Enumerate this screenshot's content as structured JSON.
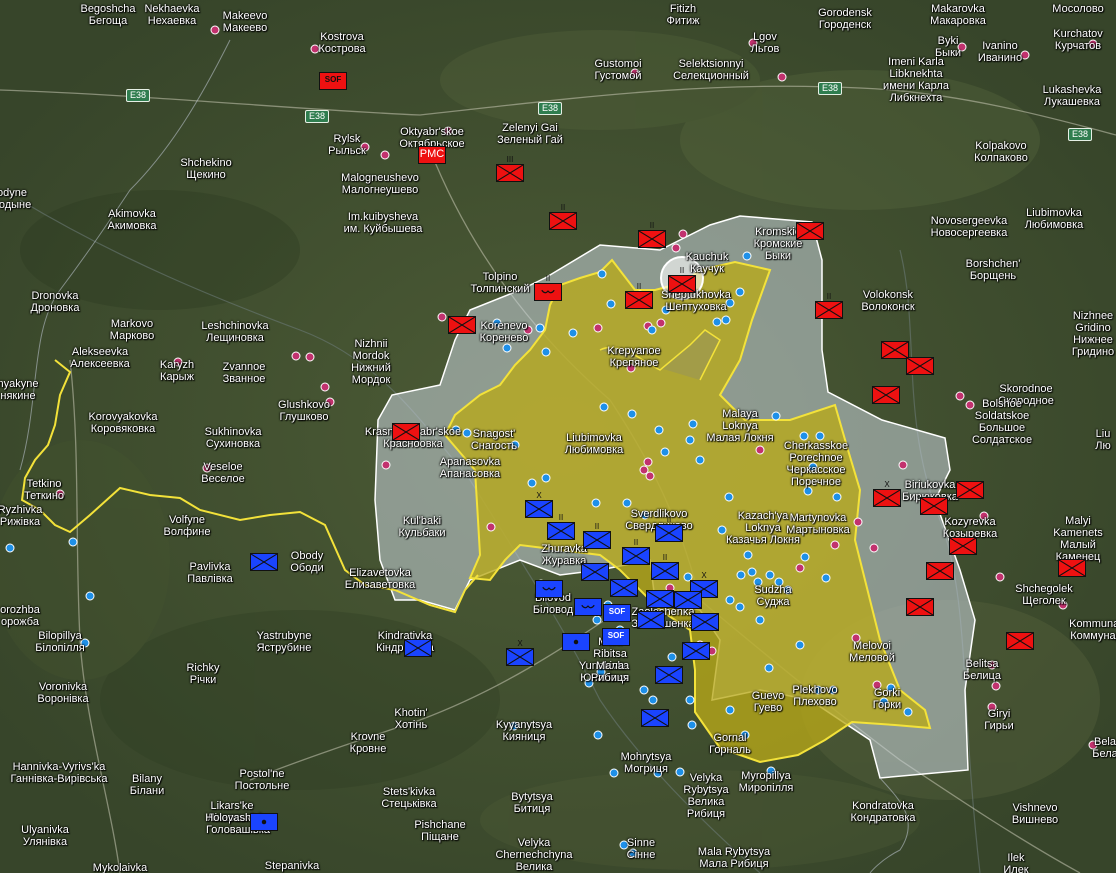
{
  "colors": {
    "ru_unit": "#ee1111",
    "ua_unit": "#1a44ff",
    "control_area": "#b8a918",
    "contested_area": "#c9d3dc",
    "border": "#f3e23a",
    "town_dot": "#c2326e",
    "control_dot": "#1e90e8"
  },
  "roads": [
    {
      "id": "e38-a",
      "label": "E38"
    },
    {
      "id": "e38-b",
      "label": "E38"
    },
    {
      "id": "e38-c",
      "label": "E38"
    },
    {
      "id": "e38-d",
      "label": "E38"
    },
    {
      "id": "e38-e",
      "label": "E38"
    }
  ],
  "places": [
    {
      "id": "begoshcha",
      "lines": [
        "Begoshcha",
        "Бегоща"
      ]
    },
    {
      "id": "nekhaevka",
      "lines": [
        "Nekhaevka",
        "Нехаевка"
      ]
    },
    {
      "id": "makeevo",
      "lines": [
        "Makeevo",
        "Макеево"
      ]
    },
    {
      "id": "kostrova",
      "lines": [
        "Kostrova",
        "Кострова"
      ]
    },
    {
      "id": "fitizh",
      "lines": [
        "Fitizh",
        "Фитиж"
      ]
    },
    {
      "id": "lgov",
      "lines": [
        "Lgov",
        "Льгов"
      ]
    },
    {
      "id": "gorodensk",
      "lines": [
        "Gorodensk",
        "Городенск"
      ]
    },
    {
      "id": "makarovka",
      "lines": [
        "Makarovka",
        "Макаровка"
      ]
    },
    {
      "id": "mosolovo",
      "lines": [
        "",
        "Мосолово"
      ]
    },
    {
      "id": "byki",
      "lines": [
        "Byki",
        "Быки"
      ]
    },
    {
      "id": "ivanino",
      "lines": [
        "Ivanino",
        "Иванино"
      ]
    },
    {
      "id": "kurchatov",
      "lines": [
        "Kurchatov",
        "Курчатов"
      ]
    },
    {
      "id": "gustomoi",
      "lines": [
        "Gustomoi",
        "Густомой"
      ]
    },
    {
      "id": "selektsionnyi",
      "lines": [
        "Selektsionnyi",
        "Селекционный"
      ]
    },
    {
      "id": "imeni-karla",
      "lines": [
        "Imeni Karla",
        "Libknekhta",
        "имени Карла",
        "Либкнехта"
      ]
    },
    {
      "id": "lukashevka",
      "lines": [
        "Lukashevka",
        "Лукашевка"
      ]
    },
    {
      "id": "rylsk",
      "lines": [
        "Rylsk",
        "Рыльск"
      ]
    },
    {
      "id": "oktyabrskoe",
      "lines": [
        "Oktyabr'skoe",
        "Октябрьское"
      ]
    },
    {
      "id": "zelenyi-gai",
      "lines": [
        "Zelenyi Gai",
        "Зеленый Гай"
      ]
    },
    {
      "id": "malogneushevo",
      "lines": [
        "Malogneushevo",
        "Малогнеушево"
      ]
    },
    {
      "id": "shchekino",
      "lines": [
        "Shchekino",
        "Щекино"
      ]
    },
    {
      "id": "kolpakovo",
      "lines": [
        "Kolpakovo",
        "Колпаково"
      ]
    },
    {
      "id": "odyne",
      "lines": [
        "odyne",
        "родыне"
      ]
    },
    {
      "id": "akimovka",
      "lines": [
        "Akimovka",
        "Акимовка"
      ]
    },
    {
      "id": "kuibysheva",
      "lines": [
        "Im.kuibysheva",
        "им. Куйбышева"
      ]
    },
    {
      "id": "novosergeevka",
      "lines": [
        "Novosergeevka",
        "Новосергеевка"
      ]
    },
    {
      "id": "liubimovka-ne",
      "lines": [
        "Liubimovka",
        "Любимовка"
      ]
    },
    {
      "id": "kromskie-byki",
      "lines": [
        "Kromskie",
        "Кромские",
        "Быки"
      ]
    },
    {
      "id": "kauchuk",
      "lines": [
        "Kauchuk",
        "Каучук"
      ]
    },
    {
      "id": "tolpino",
      "lines": [
        "Tolpino",
        "Толпинский"
      ]
    },
    {
      "id": "sheptukhovka",
      "lines": [
        "Sheptukhovka",
        "Шептуховка"
      ]
    },
    {
      "id": "borshchen",
      "lines": [
        "Borshchen'",
        "Борщень"
      ]
    },
    {
      "id": "dronovka",
      "lines": [
        "Dronovka",
        "Дроновка"
      ]
    },
    {
      "id": "volokonsk",
      "lines": [
        "Volokonsk",
        "Волоконск"
      ]
    },
    {
      "id": "korenevo",
      "lines": [
        "Korenevo",
        "Коренево"
      ]
    },
    {
      "id": "markovo",
      "lines": [
        "Markovo",
        "Марково"
      ]
    },
    {
      "id": "leshchinovka",
      "lines": [
        "Leshchinovka",
        "Лещиновка"
      ]
    },
    {
      "id": "nizhnii-mordok",
      "lines": [
        "Nizhnii",
        "Mordok",
        "Нижний",
        "Мордок"
      ]
    },
    {
      "id": "krepyanoe",
      "lines": [
        "Krepyanoe",
        "Крепяное"
      ]
    },
    {
      "id": "nizhnee-gridino",
      "lines": [
        "Nizhnee",
        "Gridino",
        "Нижнее",
        "Гридино"
      ]
    },
    {
      "id": "alekseevka",
      "lines": [
        "Alekseevka",
        "Алексеевка"
      ]
    },
    {
      "id": "karyzh",
      "lines": [
        "Karyzh",
        "Карыж"
      ]
    },
    {
      "id": "zvannoe",
      "lines": [
        "Zvannoe",
        "Званное"
      ]
    },
    {
      "id": "glushkovo",
      "lines": [
        "Glushkovo",
        "Глушково"
      ]
    },
    {
      "id": "skorodnoe",
      "lines": [
        "Skorodnoe",
        "Скородное"
      ]
    },
    {
      "id": "bolshoe-soldatskoe",
      "lines": [
        "Bolshoe",
        "Soldatskoe",
        "Большое",
        "Солдатское"
      ]
    },
    {
      "id": "nyakyne",
      "lines": [
        "nyakyne",
        "някине"
      ]
    },
    {
      "id": "korovyakovka",
      "lines": [
        "Korovyakovka",
        "Коровяковка"
      ]
    },
    {
      "id": "sukhinovka",
      "lines": [
        "Sukhinovka",
        "Сухиновка"
      ]
    },
    {
      "id": "snagost",
      "lines": [
        "Snagost'",
        "Снагость"
      ]
    },
    {
      "id": "liubimovka",
      "lines": [
        "Liubimovka",
        "Любимовка"
      ]
    },
    {
      "id": "malaya-loknya",
      "lines": [
        "Malaya",
        "Loknya",
        "Малая Локня"
      ]
    },
    {
      "id": "cherkasskoe-porechnoe",
      "lines": [
        "Cherkasskoe",
        "Porechnoe",
        "Черкасское",
        "Поречное"
      ]
    },
    {
      "id": "krasnooktyabrskoe",
      "lines": [
        "Krasnooktyabr'skoe",
        "Красноовка"
      ]
    },
    {
      "id": "liu",
      "lines": [
        "Liu",
        "Лю"
      ]
    },
    {
      "id": "apanasovka",
      "lines": [
        "Apanasovka",
        "Апанасовка"
      ]
    },
    {
      "id": "veseloe",
      "lines": [
        "Veseloe",
        "Веселое"
      ]
    },
    {
      "id": "tetkino",
      "lines": [
        "Tetkino",
        "Теткино"
      ]
    },
    {
      "id": "ryzhivka",
      "lines": [
        "Ryzhivka",
        "Рижівка"
      ]
    },
    {
      "id": "biriukovka",
      "lines": [
        "Biriukovka",
        "Бирюковка"
      ]
    },
    {
      "id": "volfyne",
      "lines": [
        "Volfyne",
        "Волфине"
      ]
    },
    {
      "id": "kulbaki",
      "lines": [
        "Kul'baki",
        "Кульбаки"
      ]
    },
    {
      "id": "sverdlikovo",
      "lines": [
        "Sverdlikovo",
        "Свердликово"
      ]
    },
    {
      "id": "kazachya-loknya",
      "lines": [
        "Kazach'ya",
        "Loknya",
        "Казачья Локня"
      ]
    },
    {
      "id": "martynovka",
      "lines": [
        "Martynovka",
        "Мартыновка"
      ]
    },
    {
      "id": "kozyrevka",
      "lines": [
        "Kozyrevka",
        "Козыревка"
      ]
    },
    {
      "id": "malyi-kamenets",
      "lines": [
        "Malyi",
        "Kamenets",
        "Малый",
        "Каменец"
      ]
    },
    {
      "id": "zhuravka",
      "lines": [
        "Zhuravka",
        "Журавка"
      ]
    },
    {
      "id": "pavlivka",
      "lines": [
        "Pavlivka",
        "Павлівка"
      ]
    },
    {
      "id": "obody",
      "lines": [
        "Obody",
        "Ободи"
      ]
    },
    {
      "id": "elizavetovka",
      "lines": [
        "Elizavetovka",
        "Елизаветовка"
      ]
    },
    {
      "id": "sudzha",
      "lines": [
        "Sudzha",
        "Суджа"
      ]
    },
    {
      "id": "shchegolek",
      "lines": [
        "Shchegolek",
        "Щеголек"
      ]
    },
    {
      "id": "bilovod",
      "lines": [
        "Bilovod",
        "Біловод"
      ]
    },
    {
      "id": "kommunar",
      "lines": [
        "Kommunar",
        "Коммунар"
      ]
    },
    {
      "id": "orozhba",
      "lines": [
        "orozhba",
        "орожба"
      ]
    },
    {
      "id": "bilopillya",
      "lines": [
        "Bilopillya",
        "Білопілля"
      ]
    },
    {
      "id": "yastrubyne",
      "lines": [
        "Yastrubyne",
        "Яструбине"
      ]
    },
    {
      "id": "kindrativka",
      "lines": [
        "Kindrativka",
        "Кіндратівка"
      ]
    },
    {
      "id": "zaoleshenka",
      "lines": [
        "Zaoleshenka",
        "Заолешенка"
      ]
    },
    {
      "id": "melovoi",
      "lines": [
        "Melovoi",
        "Меловой"
      ]
    },
    {
      "id": "yunakivka",
      "lines": [
        "Yunakivka",
        "Юнаківка"
      ]
    },
    {
      "id": "malaya-rybitsa",
      "lines": [
        "Mala",
        "Ribitsa",
        "Мала",
        "Рибиця"
      ]
    },
    {
      "id": "gorki",
      "lines": [
        "Gorki",
        "Горки"
      ]
    },
    {
      "id": "richky",
      "lines": [
        "Richky",
        "Річки"
      ]
    },
    {
      "id": "belitsa",
      "lines": [
        "Belitsa",
        "Белица"
      ]
    },
    {
      "id": "voronivka",
      "lines": [
        "Voronivka",
        "Воронівка"
      ]
    },
    {
      "id": "guevo",
      "lines": [
        "Guevo",
        "Гуево"
      ]
    },
    {
      "id": "plekhovo",
      "lines": [
        "Plekhovo",
        "Плехово"
      ]
    },
    {
      "id": "giryi",
      "lines": [
        "Giryi",
        "Гирьи"
      ]
    },
    {
      "id": "khotin",
      "lines": [
        "Khotin'",
        "Хотінь"
      ]
    },
    {
      "id": "kyyanytsya",
      "lines": [
        "Kyyanytsya",
        "Кияниця"
      ]
    },
    {
      "id": "gornal",
      "lines": [
        "Gornal",
        "Горналь"
      ]
    },
    {
      "id": "bel",
      "lines": [
        "Bela",
        "Бела"
      ]
    },
    {
      "id": "krovne",
      "lines": [
        "Krovne",
        "Кровне"
      ]
    },
    {
      "id": "hannivka",
      "lines": [
        "Hannivka-Vyrivs'ka",
        "Ганнівка-Вирівська"
      ]
    },
    {
      "id": "mohrytsya",
      "lines": [
        "Mohrytsya",
        "Могриця"
      ]
    },
    {
      "id": "myropillya",
      "lines": [
        "Myropillya",
        "Миропілля"
      ]
    },
    {
      "id": "velyka-rybytsya",
      "lines": [
        "Velyka",
        "Rybytsya",
        "Велика",
        "Рибиця"
      ]
    },
    {
      "id": "bilany",
      "lines": [
        "Bilany",
        "Білани"
      ]
    },
    {
      "id": "postolne",
      "lines": [
        "Postol'ne",
        "Постольне"
      ]
    },
    {
      "id": "stetskivka",
      "lines": [
        "Stets'kivka",
        "Стецьківка"
      ]
    },
    {
      "id": "bytytsya",
      "lines": [
        "Bytytsya",
        "Битиця"
      ]
    },
    {
      "id": "kondratovka",
      "lines": [
        "Kondratovka",
        "Кондратовка"
      ]
    },
    {
      "id": "vishnevo",
      "lines": [
        "Vishnevo",
        "Вишнево"
      ]
    },
    {
      "id": "likarske",
      "lines": [
        "Likars'ke",
        "Лікарське"
      ]
    },
    {
      "id": "holovashivka",
      "lines": [
        "Holovashivka",
        "Головашівка"
      ]
    },
    {
      "id": "ulyanivka",
      "lines": [
        "Ulyanivka",
        "Улянівка"
      ]
    },
    {
      "id": "pishchane",
      "lines": [
        "Pishchane",
        "Піщане"
      ]
    },
    {
      "id": "velyka-chernechchyna",
      "lines": [
        "Velyka",
        "Chernechchyna",
        "Велика"
      ]
    },
    {
      "id": "sinne",
      "lines": [
        "Sinne",
        "Сінне"
      ]
    },
    {
      "id": "mala-rybytsya",
      "lines": [
        "Mala Rybytsya",
        "Мала Рибиця"
      ]
    },
    {
      "id": "ilek",
      "lines": [
        "Ilek",
        "Илек"
      ]
    },
    {
      "id": "mykolaivka",
      "lines": [
        "Mykolaivka",
        ""
      ]
    },
    {
      "id": "stepanivka",
      "lines": [
        "Stepanivka",
        ""
      ]
    }
  ],
  "units": [
    {
      "id": "ru-sof-1",
      "side": "red",
      "label": "SOF",
      "symbol": "text"
    },
    {
      "id": "ru-pmc",
      "side": "red",
      "label": "PMC",
      "symbol": "text"
    },
    {
      "id": "ru-inf-1",
      "side": "red",
      "label": "",
      "symbol": "x",
      "echelon": "III"
    },
    {
      "id": "ru-inf-2",
      "side": "red",
      "label": "",
      "symbol": "x",
      "echelon": "II"
    },
    {
      "id": "ru-abn-1",
      "side": "red",
      "label": "",
      "symbol": "x-abn",
      "echelon": "II"
    },
    {
      "id": "ru-inf-3",
      "side": "red",
      "label": "",
      "symbol": "x"
    },
    {
      "id": "ru-inf-4",
      "side": "red",
      "label": "",
      "symbol": "x",
      "echelon": "II"
    },
    {
      "id": "ru-abn-2",
      "side": "red",
      "label": "",
      "symbol": "abn",
      "echelon": "II"
    },
    {
      "id": "ru-inf-5",
      "side": "red",
      "label": "",
      "symbol": "x",
      "echelon": "II"
    },
    {
      "id": "ru-inf-6",
      "side": "red",
      "label": "",
      "symbol": "x"
    },
    {
      "id": "ru-inf-7",
      "side": "red",
      "label": "",
      "symbol": "x",
      "echelon": "II"
    },
    {
      "id": "ru-inf-8",
      "side": "red",
      "label": "",
      "symbol": "x"
    },
    {
      "id": "ru-inf-9",
      "side": "red",
      "label": "",
      "symbol": "x"
    },
    {
      "id": "ru-inf-10",
      "side": "red",
      "label": "",
      "symbol": "x"
    },
    {
      "id": "ru-inf-11",
      "side": "red",
      "label": "",
      "symbol": "x"
    },
    {
      "id": "ru-inf-12",
      "side": "red",
      "label": "",
      "symbol": "x",
      "echelon": "X"
    },
    {
      "id": "ru-inf-13",
      "side": "red",
      "label": "",
      "symbol": "x"
    },
    {
      "id": "ru-inf-14",
      "side": "red",
      "label": "",
      "symbol": "x"
    },
    {
      "id": "ru-inf-15",
      "side": "red",
      "label": "",
      "symbol": "x"
    },
    {
      "id": "ru-inf-16",
      "side": "red",
      "label": "",
      "symbol": "x"
    },
    {
      "id": "ru-inf-17",
      "side": "red",
      "label": "",
      "symbol": "x"
    },
    {
      "id": "ru-inf-18",
      "side": "red",
      "label": "",
      "symbol": "x"
    },
    {
      "id": "ru-inf-19",
      "side": "red",
      "label": "",
      "symbol": "x"
    },
    {
      "id": "ru-inf-20",
      "side": "red",
      "label": "",
      "symbol": "x"
    },
    {
      "id": "ru-inf-21",
      "side": "red",
      "label": "",
      "symbol": "x"
    },
    {
      "id": "ru-inf-22",
      "side": "red",
      "label": "",
      "symbol": "x"
    },
    {
      "id": "ru-inf-23",
      "side": "red",
      "label": "",
      "symbol": "x"
    },
    {
      "id": "ua-inf-1",
      "side": "blue",
      "label": "",
      "symbol": "x",
      "echelon": "X"
    },
    {
      "id": "ua-inf-2",
      "side": "blue",
      "label": "",
      "symbol": "x",
      "echelon": "II"
    },
    {
      "id": "ua-inf-3",
      "side": "blue",
      "label": "",
      "symbol": "x",
      "echelon": "II"
    },
    {
      "id": "ua-inf-4",
      "side": "blue",
      "label": "",
      "symbol": "x",
      "echelon": "II"
    },
    {
      "id": "ua-inf-5",
      "side": "blue",
      "label": "",
      "symbol": "x",
      "echelon": "II"
    },
    {
      "id": "ua-inf-6",
      "side": "blue",
      "label": "",
      "symbol": "x",
      "echelon": "II"
    },
    {
      "id": "ua-inf-7",
      "side": "blue",
      "label": "",
      "symbol": "x"
    },
    {
      "id": "ua-abn-1",
      "side": "blue",
      "label": "",
      "symbol": "abn"
    },
    {
      "id": "ua-abn-2",
      "side": "blue",
      "label": "",
      "symbol": "abn"
    },
    {
      "id": "ua-sof-1",
      "side": "blue",
      "label": "SOF",
      "symbol": "text"
    },
    {
      "id": "ua-sof-2",
      "side": "blue",
      "label": "SOF",
      "symbol": "text"
    },
    {
      "id": "ua-inf-8",
      "side": "blue",
      "label": "",
      "symbol": "x"
    },
    {
      "id": "ua-inf-9",
      "side": "blue",
      "label": "",
      "symbol": "x"
    },
    {
      "id": "ua-inf-10",
      "side": "blue",
      "label": "",
      "symbol": "x",
      "echelon": "X"
    },
    {
      "id": "ua-inf-11",
      "side": "blue",
      "label": "",
      "symbol": "x"
    },
    {
      "id": "ua-inf-12",
      "side": "blue",
      "label": "",
      "symbol": "x"
    },
    {
      "id": "ua-inf-13",
      "side": "blue",
      "label": "",
      "symbol": "x"
    },
    {
      "id": "ua-inf-14",
      "side": "blue",
      "label": "",
      "symbol": "x"
    },
    {
      "id": "ua-inf-15",
      "side": "blue",
      "label": "",
      "symbol": "x"
    },
    {
      "id": "ua-dot-1",
      "side": "blue",
      "label": "",
      "symbol": "dot"
    },
    {
      "id": "ua-dot-2",
      "side": "blue",
      "label": "",
      "symbol": "dot"
    },
    {
      "id": "ua-inf-16",
      "side": "blue",
      "label": "",
      "symbol": "x",
      "echelon": "X"
    },
    {
      "id": "ua-inf-17",
      "side": "blue",
      "label": "",
      "symbol": "x"
    },
    {
      "id": "ua-inf-18",
      "side": "blue",
      "label": "",
      "symbol": "x"
    },
    {
      "id": "ua-inf-19",
      "side": "blue",
      "label": "",
      "symbol": "x"
    }
  ]
}
